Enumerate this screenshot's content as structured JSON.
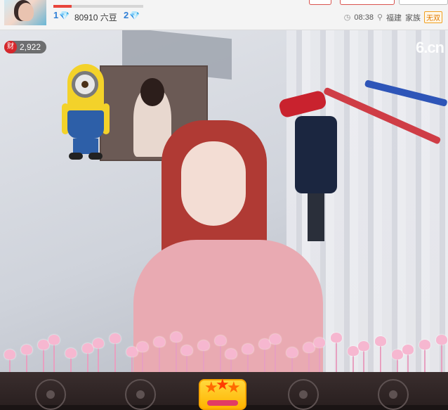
{
  "header": {
    "level_left": "1",
    "level_right": "2",
    "beans": "80910 六豆",
    "progress_fraction": 0.2,
    "time": "08:38",
    "location": "福建",
    "family_label": "家族",
    "family_badge": "无双"
  },
  "stream": {
    "wealth_count": "2,922",
    "wealth_icon_char": "财",
    "watermark": "6.cn"
  },
  "toolbar": {
    "buttons": [
      "button-1",
      "button-2",
      "star-gift",
      "button-4",
      "button-5"
    ]
  },
  "colors": {
    "accent_red": "#e8453c",
    "level_blue": "#2f7fd6",
    "badge_orange": "#e07a00"
  },
  "icons": {
    "diamond": "diamond-icon",
    "clock": "clock-icon",
    "location": "location-pin-icon",
    "wealth": "wealth-icon",
    "star": "star-icon"
  }
}
